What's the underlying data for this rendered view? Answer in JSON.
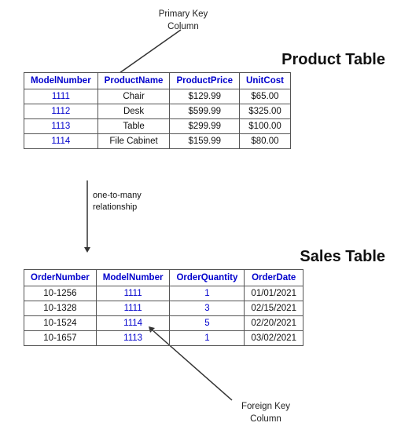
{
  "annotations": {
    "primary_key": "Primary Key\nColumn",
    "foreign_key": "Foreign Key\nColumn",
    "relationship": "one-to-many\nrelationship"
  },
  "product_table": {
    "title": "Product Table",
    "columns": [
      "ModelNumber",
      "ProductName",
      "ProductPrice",
      "UnitCost"
    ],
    "rows": [
      [
        "1111",
        "Chair",
        "$129.99",
        "$65.00"
      ],
      [
        "1112",
        "Desk",
        "$599.99",
        "$325.00"
      ],
      [
        "1113",
        "Table",
        "$299.99",
        "$100.00"
      ],
      [
        "1114",
        "File Cabinet",
        "$159.99",
        "$80.00"
      ]
    ]
  },
  "sales_table": {
    "title": "Sales Table",
    "columns": [
      "OrderNumber",
      "ModelNumber",
      "OrderQuantity",
      "OrderDate"
    ],
    "rows": [
      [
        "10-1256",
        "1111",
        "1",
        "01/01/2021"
      ],
      [
        "10-1328",
        "1111",
        "3",
        "02/15/2021"
      ],
      [
        "10-1524",
        "1114",
        "5",
        "02/20/2021"
      ],
      [
        "10-1657",
        "1113",
        "1",
        "03/02/2021"
      ]
    ]
  }
}
